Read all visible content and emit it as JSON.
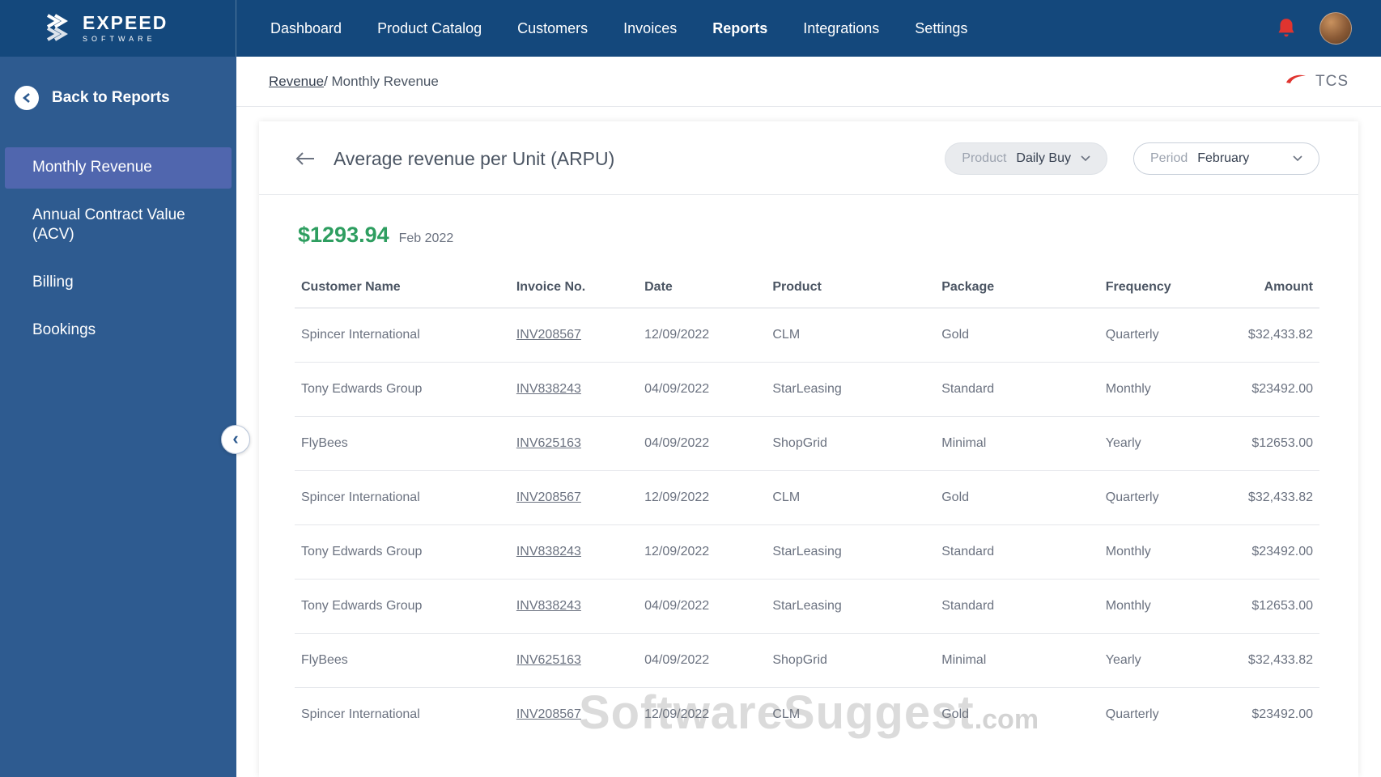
{
  "colors": {
    "navbar_bg": "#14487C",
    "sidebar_bg": "#2E5B90",
    "sidebar_active": "#5066AE",
    "accent_green": "#2E9E60",
    "alert_red": "#E0342F"
  },
  "navbar": {
    "brand_line1": "EXPEED",
    "brand_line2": "SOFTWARE",
    "items": [
      {
        "label": "Dashboard",
        "active": false
      },
      {
        "label": "Product Catalog",
        "active": false
      },
      {
        "label": "Customers",
        "active": false
      },
      {
        "label": "Invoices",
        "active": false
      },
      {
        "label": "Reports",
        "active": true
      },
      {
        "label": "Integrations",
        "active": false
      },
      {
        "label": "Settings",
        "active": false
      }
    ]
  },
  "sidebar": {
    "back_label": "Back to Reports",
    "items": [
      {
        "label": "Monthly Revenue",
        "active": true
      },
      {
        "label": "Annual Contract Value (ACV)",
        "active": false
      },
      {
        "label": "Billing",
        "active": false
      },
      {
        "label": "Bookings",
        "active": false
      }
    ]
  },
  "breadcrumb": {
    "link": "Revenue",
    "separator": "/ ",
    "current": "Monthly Revenue"
  },
  "partner": {
    "name": "TCS"
  },
  "card": {
    "title": "Average revenue per Unit (ARPU)",
    "product_filter": {
      "label": "Product",
      "value": "Daily Buy"
    },
    "period_filter": {
      "label": "Period",
      "value": "February"
    },
    "metric_value": "$1293.94",
    "metric_period": "Feb 2022"
  },
  "table": {
    "headers": [
      "Customer Name",
      "Invoice No.",
      "Date",
      "Product",
      "Package",
      "Frequency",
      "Amount"
    ],
    "rows": [
      [
        "Spincer International",
        "INV208567",
        "12/09/2022",
        "CLM",
        "Gold",
        "Quarterly",
        "$32,433.82"
      ],
      [
        "Tony Edwards Group",
        "INV838243",
        "04/09/2022",
        "StarLeasing",
        "Standard",
        "Monthly",
        "$23492.00"
      ],
      [
        "FlyBees",
        "INV625163",
        "04/09/2022",
        "ShopGrid",
        "Minimal",
        "Yearly",
        "$12653.00"
      ],
      [
        "Spincer International",
        "INV208567",
        "12/09/2022",
        "CLM",
        "Gold",
        "Quarterly",
        "$32,433.82"
      ],
      [
        "Tony Edwards Group",
        "INV838243",
        "12/09/2022",
        "StarLeasing",
        "Standard",
        "Monthly",
        "$23492.00"
      ],
      [
        "Tony Edwards Group",
        "INV838243",
        "04/09/2022",
        "StarLeasing",
        "Standard",
        "Monthly",
        "$12653.00"
      ],
      [
        "FlyBees",
        "INV625163",
        "04/09/2022",
        "ShopGrid",
        "Minimal",
        "Yearly",
        "$32,433.82"
      ],
      [
        "Spincer International",
        "INV208567",
        "12/09/2022",
        "CLM",
        "Gold",
        "Quarterly",
        "$23492.00"
      ]
    ]
  },
  "watermark": {
    "main": "SoftwareSuggest",
    "suffix": ".com"
  }
}
